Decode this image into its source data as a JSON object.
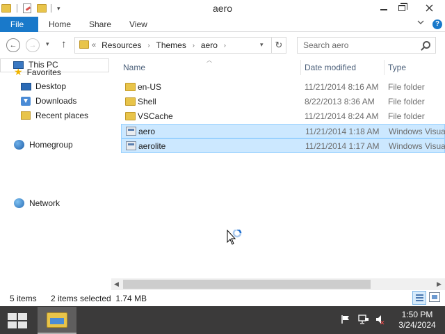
{
  "window": {
    "title": "aero",
    "quick_access_dropdown": "▾"
  },
  "ribbon": {
    "tabs": [
      {
        "label": "File"
      },
      {
        "label": "Home"
      },
      {
        "label": "Share"
      },
      {
        "label": "View"
      }
    ],
    "expand_icon": "chevron-down-icon",
    "help_label": "?"
  },
  "navigation": {
    "back_glyph": "←",
    "forward_glyph": "→",
    "recent_glyph": "▾",
    "up_glyph": "↑",
    "address": {
      "lead": "«",
      "crumbs": [
        "Resources",
        "Themes",
        "aero"
      ],
      "separator": "›",
      "dropdown": "▾"
    },
    "refresh_glyph": "↻",
    "search": {
      "placeholder": "Search aero"
    }
  },
  "navpane": {
    "favorites": {
      "label": "Favorites"
    },
    "items": [
      {
        "label": "Desktop"
      },
      {
        "label": "Downloads"
      },
      {
        "label": "Recent places"
      }
    ],
    "homegroup": {
      "label": "Homegroup"
    },
    "this_pc": {
      "label": "This PC"
    },
    "network": {
      "label": "Network"
    }
  },
  "filelist": {
    "columns": {
      "name": "Name",
      "date": "Date modified",
      "type": "Type"
    },
    "rows": [
      {
        "name": "en-US",
        "date": "11/21/2014 8:16 AM",
        "type": "File folder",
        "kind": "folder",
        "selected": false
      },
      {
        "name": "Shell",
        "date": "8/22/2013 8:36 AM",
        "type": "File folder",
        "kind": "folder",
        "selected": false
      },
      {
        "name": "VSCache",
        "date": "11/21/2014 8:24 AM",
        "type": "File folder",
        "kind": "folder",
        "selected": false
      },
      {
        "name": "aero",
        "date": "11/21/2014 1:18 AM",
        "type": "Windows Visual",
        "kind": "file",
        "selected": true
      },
      {
        "name": "aerolite",
        "date": "11/21/2014 1:17 AM",
        "type": "Windows Visual",
        "kind": "file",
        "selected": true
      }
    ]
  },
  "scrollbar": {
    "left_glyph": "◀",
    "right_glyph": "▶"
  },
  "status": {
    "items": "5 items",
    "selected": "2 items selected  1.74 MB"
  },
  "taskbar": {
    "clock_time": "1:50 PM",
    "clock_date": "3/24/2024",
    "tray_icons": [
      "flag-icon",
      "network-icon",
      "volume-muted-icon"
    ]
  },
  "colors": {
    "accent": "#1979ca",
    "selection": "#cce8ff",
    "selection_border": "#99d1ff",
    "taskbar": "#3b3a3a"
  }
}
